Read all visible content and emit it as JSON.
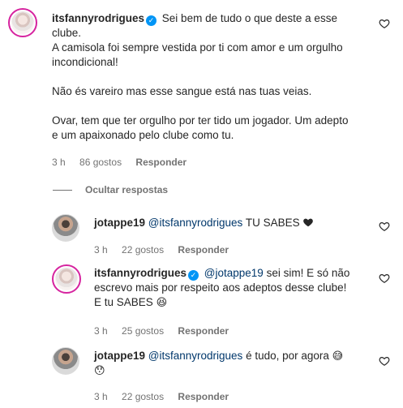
{
  "comments": [
    {
      "user": "itsfannyrodrigues",
      "verified": true,
      "lines": [
        "Sei bem de tudo o que deste a esse",
        "clube.",
        "A camisola foi sempre vestida por ti com amor e um orgulho",
        "incondicional!",
        "",
        "Não és vareiro mas esse sangue está nas tuas veias.",
        "",
        "Ovar, tem que ter orgulho por ter tido um jogador. Um adepto",
        "e um apaixonado pelo clube como tu."
      ],
      "time": "3 h",
      "likes": "86 gostos",
      "reply": "Responder"
    }
  ],
  "toggle": "Ocultar respostas",
  "replies": [
    {
      "user": "jotappe19",
      "mention": "@itsfannyrodrigues",
      "text": "TU SABES",
      "time": "3 h",
      "likes": "22 gostos",
      "reply": "Responder"
    },
    {
      "user": "itsfannyrodrigues",
      "verified": true,
      "mention": "@jotappe19",
      "text_line1": "sei sim! E só não",
      "text_line2": "escrevo mais por respeito aos adeptos desse clube!",
      "text_line3": "E tu SABES",
      "time": "3 h",
      "likes": "25 gostos",
      "reply": "Responder"
    },
    {
      "user": "jotappe19",
      "mention": "@itsfannyrodrigues",
      "text": "é tudo, por agora",
      "time": "3 h",
      "likes": "22 gostos",
      "reply": "Responder"
    }
  ],
  "icons": {
    "heart": "heart-outline-icon",
    "verified": "verified-badge-icon"
  },
  "colors": {
    "text": "#262626",
    "meta": "#737373",
    "mention": "#00376b",
    "verified": "#0095f6"
  }
}
